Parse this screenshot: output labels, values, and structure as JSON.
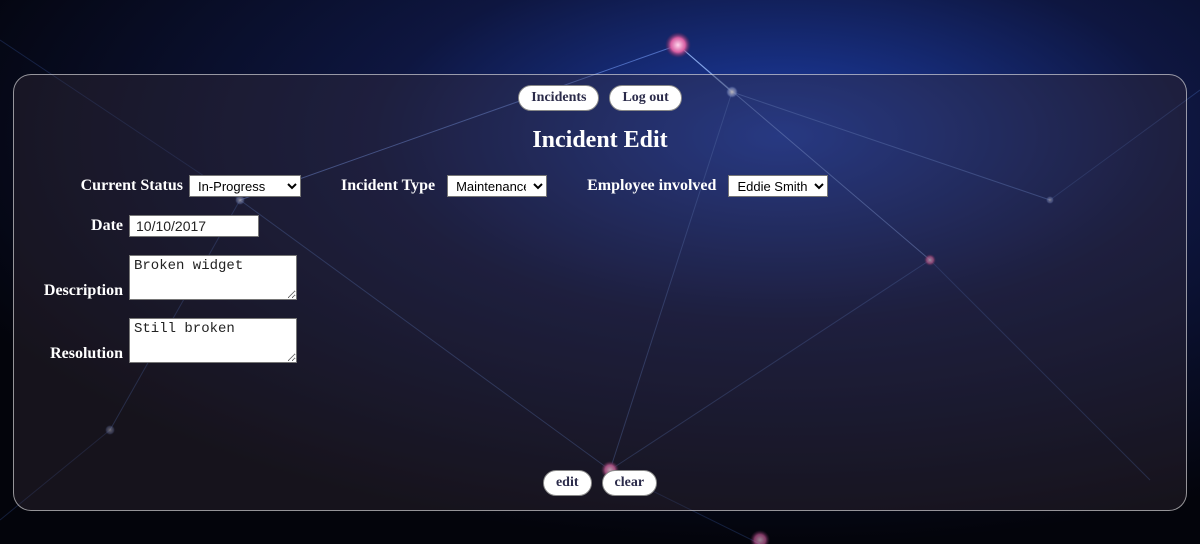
{
  "nav": {
    "incidents": "Incidents",
    "logout": "Log out"
  },
  "title": "Incident Edit",
  "labels": {
    "status": "Current Status",
    "type": "Incident Type",
    "employee": "Employee involved",
    "date": "Date",
    "description": "Description",
    "resolution": "Resolution"
  },
  "values": {
    "status": "In-Progress",
    "type": "Maintenance",
    "employee": "Eddie Smith",
    "date": "10/10/2017",
    "description": "Broken widget",
    "resolution": "Still broken"
  },
  "options": {
    "status": [
      "In-Progress"
    ],
    "type": [
      "Maintenance"
    ],
    "employee": [
      "Eddie Smith"
    ]
  },
  "actions": {
    "edit": "edit",
    "clear": "clear"
  }
}
